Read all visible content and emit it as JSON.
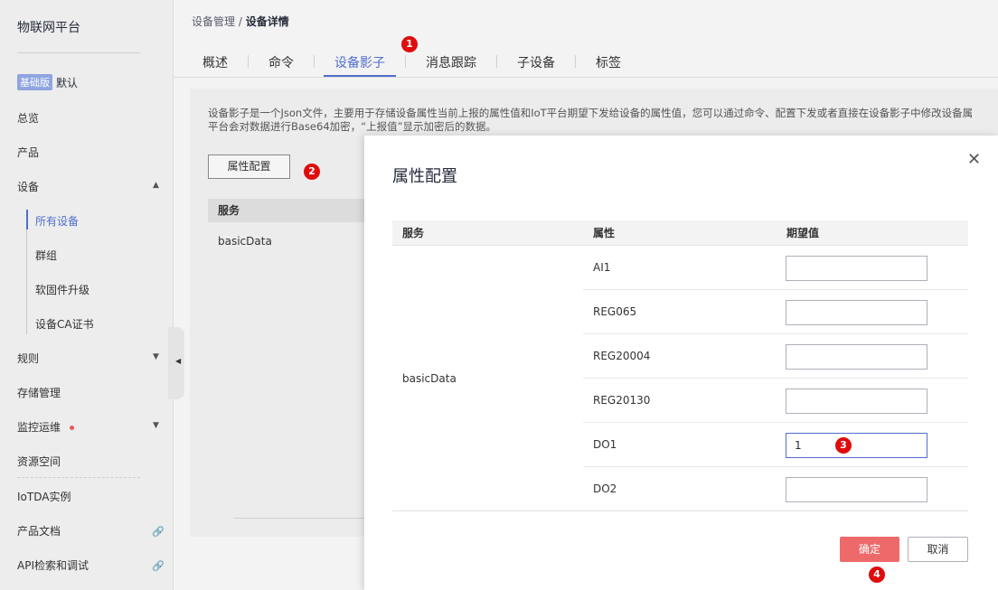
{
  "sidebar": {
    "title": "物联网平台",
    "edition_badge": "基础版",
    "edition_label": "默认",
    "items": {
      "overview": "总览",
      "product": "产品",
      "device": "设备",
      "all_devices": "所有设备",
      "group": "群组",
      "firmware": "软固件升级",
      "device_ca": "设备CA证书",
      "rules": "规则",
      "storage": "存储管理",
      "monitor": "监控运维",
      "resource": "资源空间",
      "iotda": "IoTDA实例",
      "docs": "产品文档",
      "api": "API检索和调试"
    }
  },
  "breadcrumb": {
    "parent": "设备管理",
    "sep": " / ",
    "current": "设备详情"
  },
  "tabs": [
    "概述",
    "命令",
    "设备影子",
    "消息跟踪",
    "子设备",
    "标签"
  ],
  "content": {
    "description_line1": "设备影子是一个Json文件，主要用于存储设备属性当前上报的属性值和IoT平台期望下发给设备的属性值，您可以通过命令、配置下发或者直接在设备影子中修改设备属",
    "description_line2": "平台会对数据进行Base64加密，“上报值”显示加密后的数据。",
    "attr_button": "属性配置",
    "table_header": "服务",
    "service": "basicData"
  },
  "markers": [
    "1",
    "2",
    "3",
    "4"
  ],
  "modal": {
    "title": "属性配置",
    "columns": [
      "服务",
      "属性",
      "期望值"
    ],
    "service": "basicData",
    "rows": [
      {
        "property": "AI1",
        "value": ""
      },
      {
        "property": "REG065",
        "value": ""
      },
      {
        "property": "REG20004",
        "value": ""
      },
      {
        "property": "REG20130",
        "value": ""
      },
      {
        "property": "DO1",
        "value": "1"
      },
      {
        "property": "DO2",
        "value": ""
      }
    ],
    "confirm": "确定",
    "cancel": "取消"
  }
}
